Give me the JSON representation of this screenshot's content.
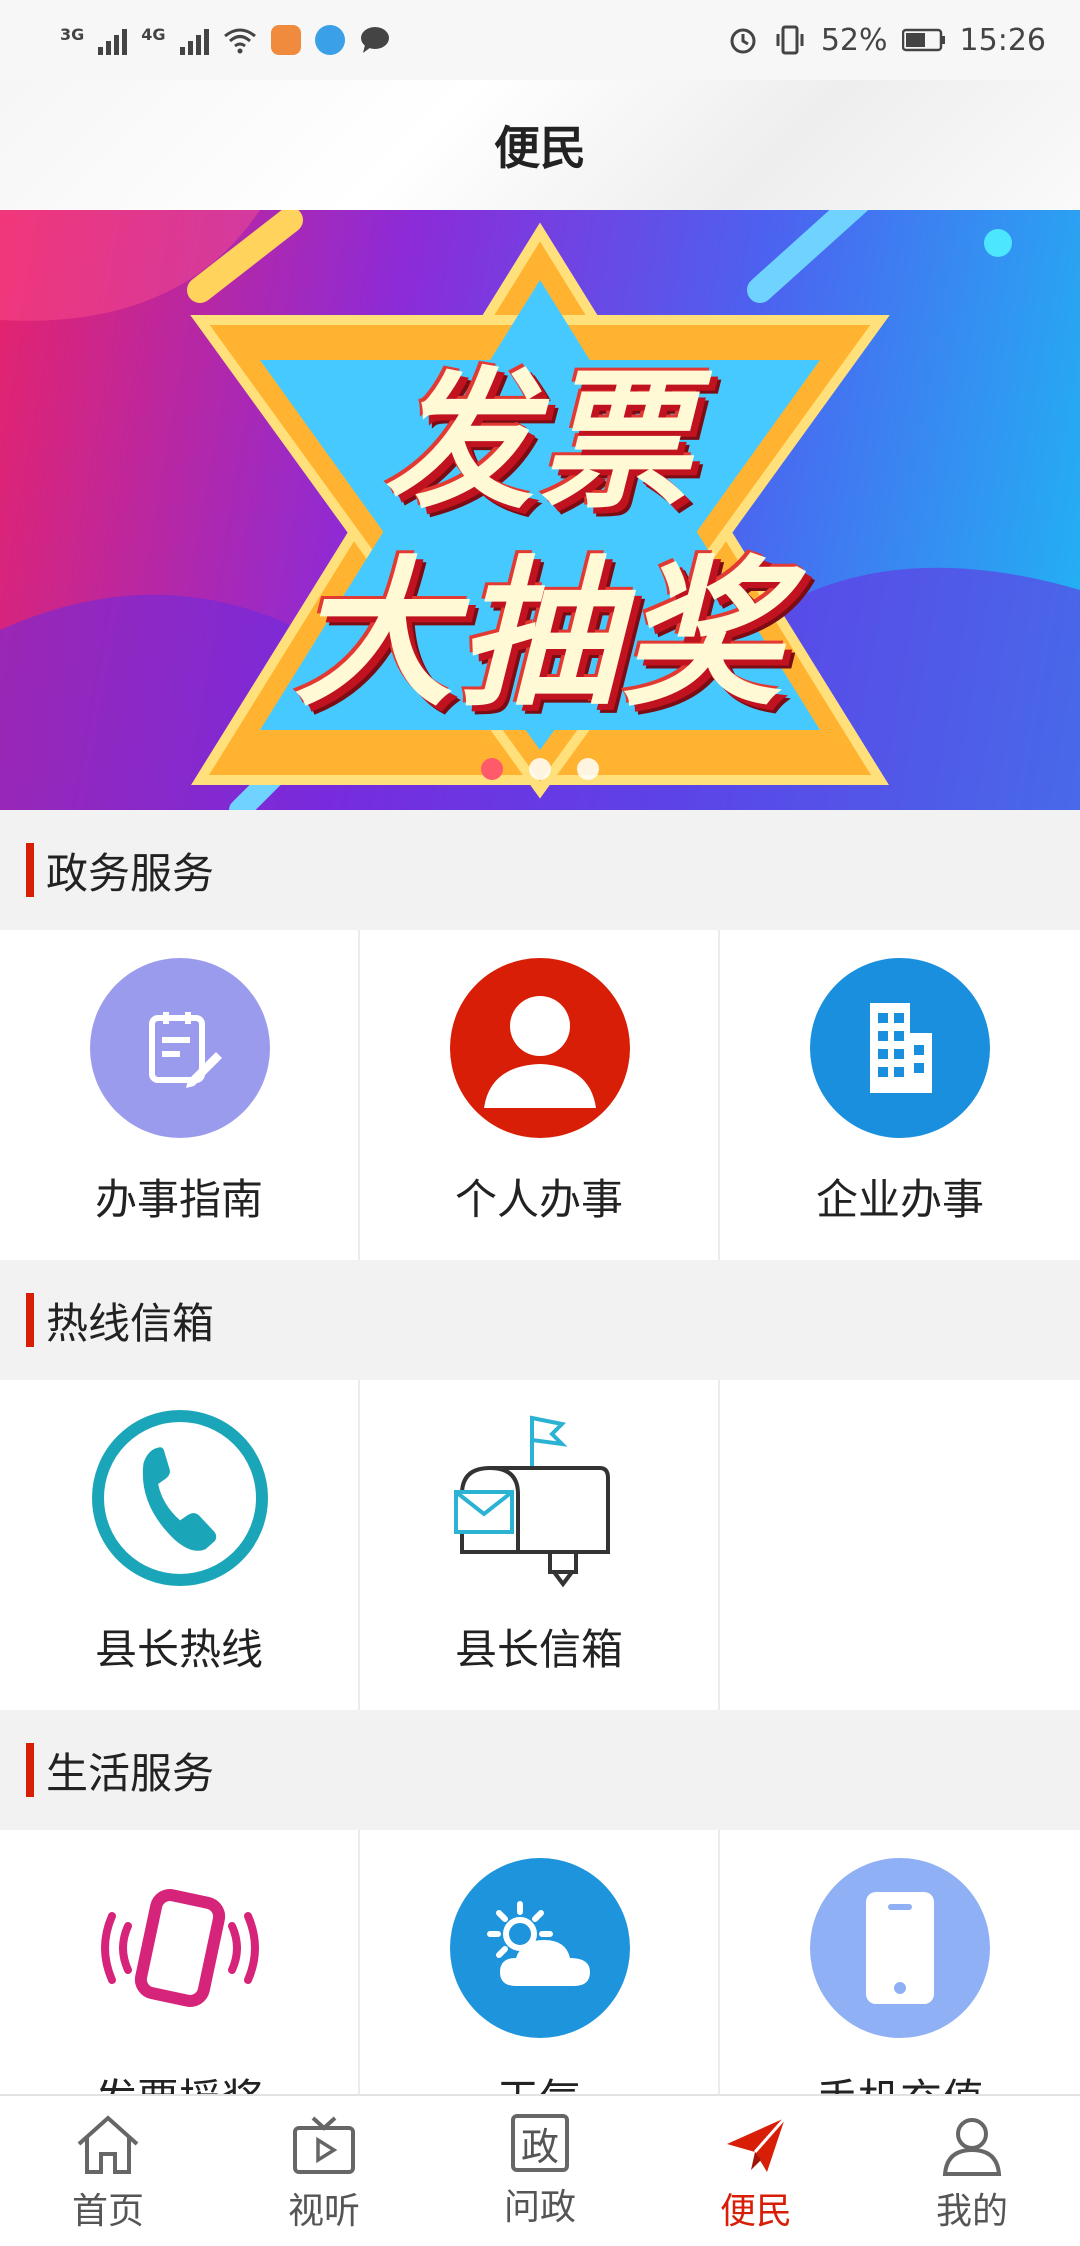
{
  "status_bar": {
    "net1": "3G",
    "net2": "4G",
    "battery": "52%",
    "time": "15:26"
  },
  "header": {
    "title": "便民"
  },
  "banner": {
    "line1": "发票",
    "line2": "大抽奖",
    "slides": 3,
    "active_slide": 1
  },
  "sections": [
    {
      "title": "政务服务",
      "items": [
        {
          "label": "办事指南",
          "icon": "clipboard-edit-icon",
          "color": "#9b9bee"
        },
        {
          "label": "个人办事",
          "icon": "person-icon",
          "color": "#d81e06"
        },
        {
          "label": "企业办事",
          "icon": "building-icon",
          "color": "#1a8fdd"
        }
      ]
    },
    {
      "title": "热线信箱",
      "items": [
        {
          "label": "县长热线",
          "icon": "phone-icon",
          "color": "#1aa5b8"
        },
        {
          "label": "县长信箱",
          "icon": "mailbox-icon",
          "color": "#2cb3d4"
        }
      ]
    },
    {
      "title": "生活服务",
      "items": [
        {
          "label": "发票摇奖",
          "icon": "shake-phone-icon",
          "color": "#d6247a"
        },
        {
          "label": "天气",
          "icon": "weather-icon",
          "color": "#1e94dc"
        },
        {
          "label": "手机充值",
          "icon": "mobile-recharge-icon",
          "color": "#8fb0f5"
        }
      ]
    }
  ],
  "tabbar": {
    "active": 3,
    "items": [
      {
        "label": "首页",
        "icon": "home-icon"
      },
      {
        "label": "视听",
        "icon": "tv-icon"
      },
      {
        "label": "问政",
        "icon": "gov-icon",
        "glyph": "政"
      },
      {
        "label": "便民",
        "icon": "paper-plane-icon"
      },
      {
        "label": "我的",
        "icon": "user-icon"
      }
    ]
  },
  "colors": {
    "accent": "#d81e06",
    "section_bg": "#f2f2f2"
  }
}
